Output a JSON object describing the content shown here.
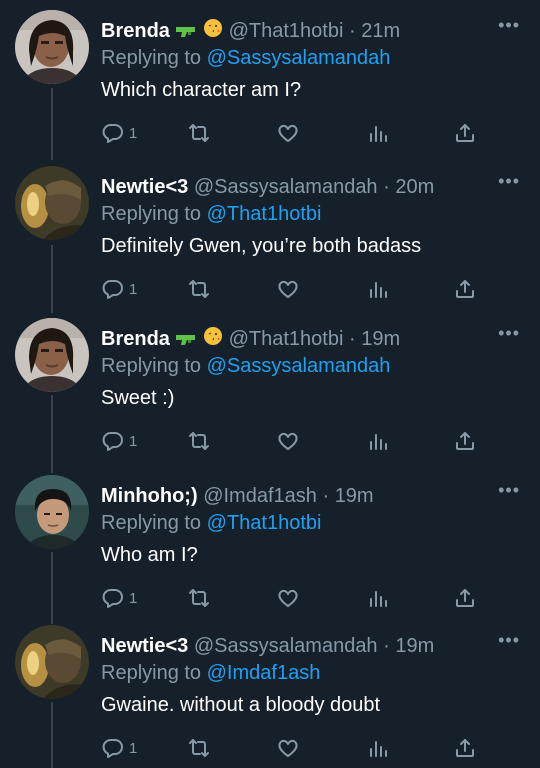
{
  "thread": {
    "more_icon": "more-dots-icon",
    "tweets": [
      {
        "author": "Brenda",
        "emojis": [
          "water-pistol",
          "face-blowing-kiss"
        ],
        "handle": "@That1hotbi",
        "dot": "·",
        "time": "21m",
        "replying_label": "Replying to ",
        "replying_to": "@Sassysalamandah",
        "text": "Which character am I?",
        "reply_count": "1",
        "retweet_count": "",
        "like_count": ""
      },
      {
        "author": "Newtie<3",
        "emojis": [],
        "handle": "@Sassysalamandah",
        "dot": "·",
        "time": "20m",
        "replying_label": "Replying to ",
        "replying_to": "@That1hotbi",
        "text": "Definitely Gwen, you’re both badass",
        "reply_count": "1",
        "retweet_count": "",
        "like_count": ""
      },
      {
        "author": "Brenda",
        "emojis": [
          "water-pistol",
          "face-blowing-kiss"
        ],
        "handle": "@That1hotbi",
        "dot": "·",
        "time": "19m",
        "replying_label": "Replying to ",
        "replying_to": "@Sassysalamandah",
        "text": "Sweet :)",
        "reply_count": "1",
        "retweet_count": "",
        "like_count": ""
      },
      {
        "author": "Minhoho;)",
        "emojis": [],
        "handle": "@Imdaf1ash",
        "dot": "·",
        "time": "19m",
        "replying_label": "Replying to ",
        "replying_to": "@That1hotbi",
        "text": "Who am I?",
        "reply_count": "1",
        "retweet_count": "",
        "like_count": ""
      },
      {
        "author": "Newtie<3",
        "emojis": [],
        "handle": "@Sassysalamandah",
        "dot": "·",
        "time": "19m",
        "replying_label": "Replying to ",
        "replying_to": "@Imdaf1ash",
        "text": "Gwaine. without a bloody doubt",
        "reply_count": "1",
        "retweet_count": "",
        "like_count": ""
      }
    ]
  },
  "colors": {
    "background": "#15202b",
    "secondary_text": "#8899a6",
    "link": "#1da1f2"
  }
}
